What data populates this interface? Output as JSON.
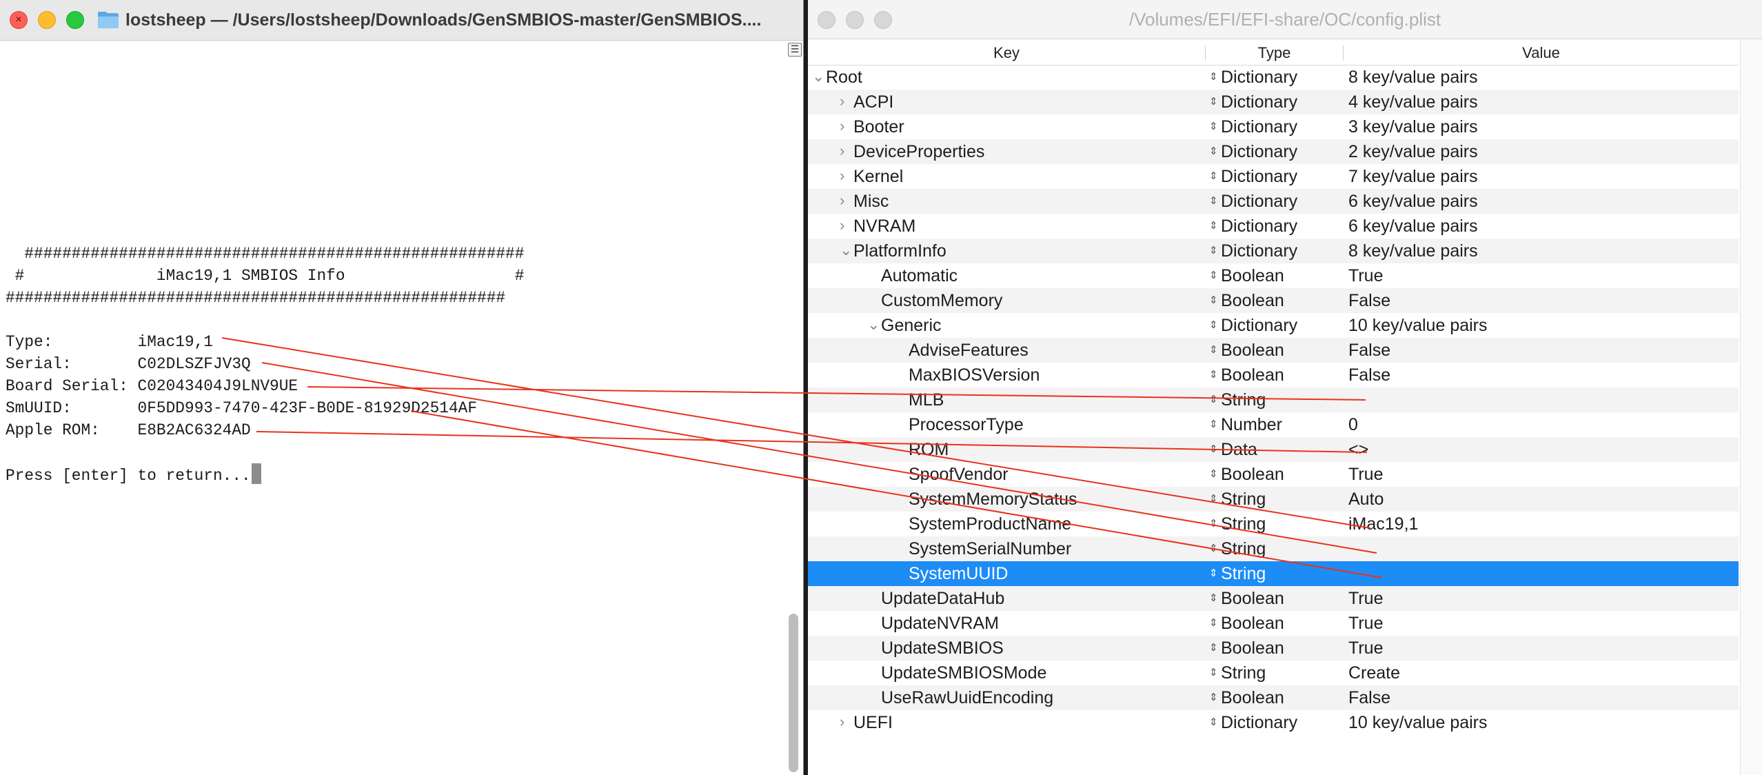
{
  "terminal": {
    "title": "lostsheep — /Users/lostsheep/Downloads/GenSMBIOS-master/GenSMBIOS....",
    "lines": [
      "  #####################################################",
      " #              iMac19,1 SMBIOS Info                  #",
      "#####################################################",
      "",
      "Type:         iMac19,1",
      "Serial:       C02DLSZFJV3Q",
      "Board Serial: C02043404J9LNV9UE",
      "SmUUID:       0F5DD993-7470-423F-B0DE-81929D2514AF",
      "Apple ROM:    E8B2AC6324AD",
      "",
      "Press [enter] to return..."
    ]
  },
  "plist": {
    "title": "/Volumes/EFI/EFI-share/OC/config.plist",
    "columns": {
      "key": "Key",
      "type": "Type",
      "value": "Value"
    },
    "rows": [
      {
        "key": "Root",
        "type": "Dictionary",
        "value": "8 key/value pairs",
        "depth": 0,
        "disclosure": "open"
      },
      {
        "key": "ACPI",
        "type": "Dictionary",
        "value": "4 key/value pairs",
        "depth": 1,
        "disclosure": "closed"
      },
      {
        "key": "Booter",
        "type": "Dictionary",
        "value": "3 key/value pairs",
        "depth": 1,
        "disclosure": "closed"
      },
      {
        "key": "DeviceProperties",
        "type": "Dictionary",
        "value": "2 key/value pairs",
        "depth": 1,
        "disclosure": "closed"
      },
      {
        "key": "Kernel",
        "type": "Dictionary",
        "value": "7 key/value pairs",
        "depth": 1,
        "disclosure": "closed"
      },
      {
        "key": "Misc",
        "type": "Dictionary",
        "value": "6 key/value pairs",
        "depth": 1,
        "disclosure": "closed"
      },
      {
        "key": "NVRAM",
        "type": "Dictionary",
        "value": "6 key/value pairs",
        "depth": 1,
        "disclosure": "closed"
      },
      {
        "key": "PlatformInfo",
        "type": "Dictionary",
        "value": "8 key/value pairs",
        "depth": 1,
        "disclosure": "open"
      },
      {
        "key": "Automatic",
        "type": "Boolean",
        "value": "True",
        "depth": 2,
        "disclosure": ""
      },
      {
        "key": "CustomMemory",
        "type": "Boolean",
        "value": "False",
        "depth": 2,
        "disclosure": ""
      },
      {
        "key": "Generic",
        "type": "Dictionary",
        "value": "10 key/value pairs",
        "depth": 2,
        "disclosure": "open"
      },
      {
        "key": "AdviseFeatures",
        "type": "Boolean",
        "value": "False",
        "depth": 3,
        "disclosure": ""
      },
      {
        "key": "MaxBIOSVersion",
        "type": "Boolean",
        "value": "False",
        "depth": 3,
        "disclosure": ""
      },
      {
        "key": "MLB",
        "type": "String",
        "value": "",
        "depth": 3,
        "disclosure": ""
      },
      {
        "key": "ProcessorType",
        "type": "Number",
        "value": "0",
        "depth": 3,
        "disclosure": ""
      },
      {
        "key": "ROM",
        "type": "Data",
        "value": "<>",
        "depth": 3,
        "disclosure": ""
      },
      {
        "key": "SpoofVendor",
        "type": "Boolean",
        "value": "True",
        "depth": 3,
        "disclosure": ""
      },
      {
        "key": "SystemMemoryStatus",
        "type": "String",
        "value": "Auto",
        "depth": 3,
        "disclosure": ""
      },
      {
        "key": "SystemProductName",
        "type": "String",
        "value": "iMac19,1",
        "depth": 3,
        "disclosure": ""
      },
      {
        "key": "SystemSerialNumber",
        "type": "String",
        "value": "",
        "depth": 3,
        "disclosure": ""
      },
      {
        "key": "SystemUUID",
        "type": "String",
        "value": "",
        "depth": 3,
        "disclosure": "",
        "selected": true
      },
      {
        "key": "UpdateDataHub",
        "type": "Boolean",
        "value": "True",
        "depth": 2,
        "disclosure": ""
      },
      {
        "key": "UpdateNVRAM",
        "type": "Boolean",
        "value": "True",
        "depth": 2,
        "disclosure": ""
      },
      {
        "key": "UpdateSMBIOS",
        "type": "Boolean",
        "value": "True",
        "depth": 2,
        "disclosure": ""
      },
      {
        "key": "UpdateSMBIOSMode",
        "type": "String",
        "value": "Create",
        "depth": 2,
        "disclosure": ""
      },
      {
        "key": "UseRawUuidEncoding",
        "type": "Boolean",
        "value": "False",
        "depth": 2,
        "disclosure": ""
      },
      {
        "key": "UEFI",
        "type": "Dictionary",
        "value": "10 key/value pairs",
        "depth": 1,
        "disclosure": "closed"
      }
    ]
  },
  "annotations": {
    "line_color": "#e8331c",
    "links": [
      {
        "from": "Type",
        "to": "SystemProductName"
      },
      {
        "from": "Serial",
        "to": "SystemSerialNumber"
      },
      {
        "from": "Board Serial",
        "to": "MLB"
      },
      {
        "from": "SmUUID",
        "to": "SystemUUID"
      },
      {
        "from": "Apple ROM",
        "to": "ROM"
      }
    ]
  },
  "colors": {
    "selection": "#1d8cf5",
    "close": "#fe5f57",
    "minimize": "#febc2e",
    "zoom": "#28c840"
  }
}
